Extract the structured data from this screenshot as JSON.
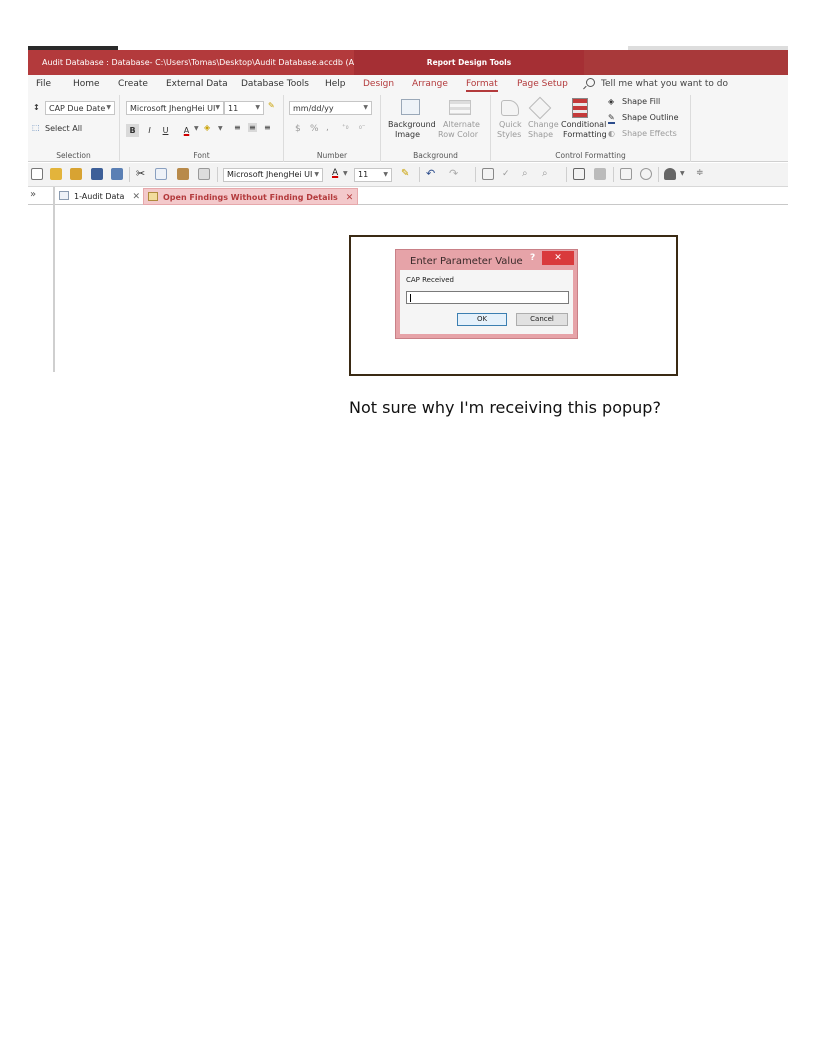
{
  "window": {
    "title": "Audit Database : Database- C:\\Users\\Tomas\\Desktop\\Audit Database.accdb (Ac...",
    "contextual_title": "Report Design Tools",
    "accent_color": "#b33a3c"
  },
  "ribbon_tabs": [
    {
      "label": "File"
    },
    {
      "label": "Home"
    },
    {
      "label": "Create"
    },
    {
      "label": "External Data"
    },
    {
      "label": "Database Tools"
    },
    {
      "label": "Help"
    },
    {
      "label": "Design"
    },
    {
      "label": "Arrange"
    },
    {
      "label": "Format",
      "active": true
    },
    {
      "label": "Page Setup"
    }
  ],
  "tell_me": "Tell me what you want to do",
  "ribbon": {
    "selection": {
      "label": "Selection",
      "object_dropdown": "CAP Due Date",
      "select_all": "Select All"
    },
    "font": {
      "label": "Font",
      "font_name": "Microsoft JhengHei UI",
      "font_size": "11",
      "bold": "B",
      "italic": "I",
      "underline": "U",
      "font_color": "A"
    },
    "number": {
      "label": "Number",
      "format": "mm/dd/yy",
      "currency": "$",
      "percent": "%",
      "comma": ","
    },
    "background": {
      "label": "Background",
      "background_image_1": "Background",
      "background_image_2": "Image",
      "alternate_row_1": "Alternate",
      "alternate_row_2": "Row Color"
    },
    "control_formatting": {
      "label": "Control Formatting",
      "quick_styles_1": "Quick",
      "quick_styles_2": "Styles",
      "change_shape_1": "Change",
      "change_shape_2": "Shape",
      "conditional_1": "Conditional",
      "conditional_2": "Formatting",
      "shape_fill": "Shape Fill",
      "shape_outline": "Shape Outline",
      "shape_effects": "Shape Effects"
    }
  },
  "quick_access": {
    "font_name": "Microsoft JhengHei UI",
    "font_size": "11",
    "font_color": "A"
  },
  "document_tabs": [
    {
      "label": "1-Audit Data"
    },
    {
      "label": "Open Findings Without Finding Details",
      "active": true
    }
  ],
  "dialog": {
    "title": "Enter Parameter Value",
    "help": "?",
    "close": "✕",
    "prompt": "CAP Received",
    "value": "",
    "ok_label": "OK",
    "cancel_label": "Cancel"
  },
  "caption": "Not sure why I'm receiving this popup?"
}
